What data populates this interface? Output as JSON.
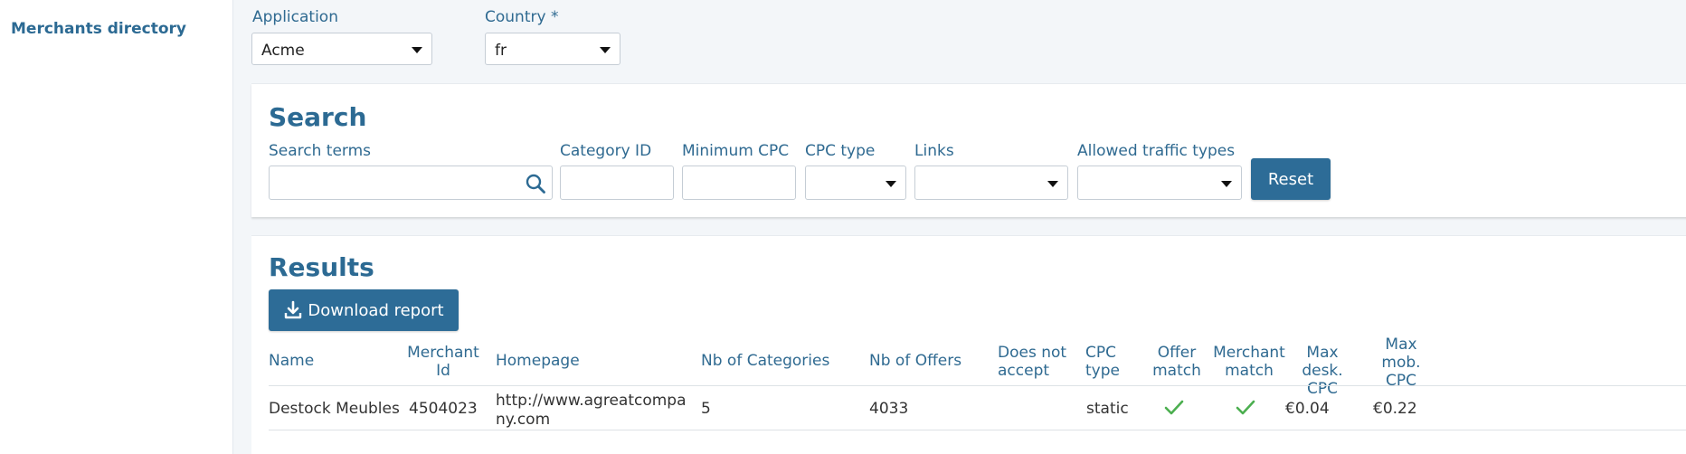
{
  "sidebar": {
    "merchants_link": "Merchants directory"
  },
  "filters": {
    "application_label": "Application",
    "application_value": "Acme",
    "country_label": "Country *",
    "country_value": "fr"
  },
  "search": {
    "title": "Search",
    "search_terms_label": "Search terms",
    "search_terms_value": "",
    "category_id_label": "Category ID",
    "minimum_cpc_label": "Minimum CPC",
    "cpc_type_label": "CPC type",
    "links_label": "Links",
    "allowed_traffic_label": "Allowed traffic types",
    "reset_label": "Reset"
  },
  "results": {
    "title": "Results",
    "download_label": "Download report",
    "columns": {
      "name": "Name",
      "merchant_id": "Merchant Id",
      "homepage": "Homepage",
      "nb_categories": "Nb of Categories",
      "nb_offers": "Nb of Offers",
      "does_not_accept": "Does not accept",
      "cpc_type": "CPC type",
      "offer_match": "Offer match",
      "merchant_match": "Merchant match",
      "max_desk_cpc": "Max desk. CPC",
      "max_mob_cpc": "Max mob. CPC"
    },
    "rows": [
      {
        "name": "Destock Meubles",
        "merchant_id": "4504023",
        "homepage": "http://www.agreatcompany.com",
        "nb_categories": "5",
        "nb_offers": "4033",
        "does_not_accept": "",
        "cpc_type": "static",
        "offer_match": true,
        "merchant_match": true,
        "max_desk_cpc": "€0.04",
        "max_mob_cpc": "€0.22"
      }
    ]
  },
  "colors": {
    "brand": "#2c6a93",
    "button": "#2d6c97",
    "check": "#4caf50"
  },
  "icons": {
    "search": "search-icon",
    "download": "download-icon",
    "check": "check-icon",
    "caret": "caret-down-icon"
  }
}
